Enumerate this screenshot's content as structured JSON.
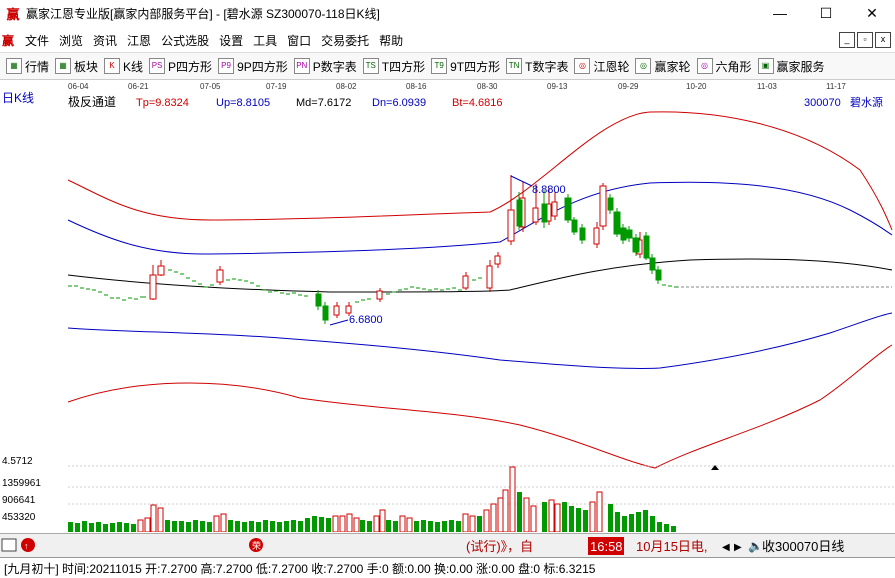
{
  "window": {
    "title": "赢家江恩专业版[赢家内部服务平台] - [碧水源  SZ300070-118日K线]",
    "logo": "赢",
    "minimize": "—",
    "maximize": "☐",
    "close": "✕"
  },
  "menu": {
    "logo": "赢",
    "items": [
      "文件",
      "浏览",
      "资讯",
      "江恩",
      "公式选股",
      "设置",
      "工具",
      "窗口",
      "交易委托",
      "帮助"
    ]
  },
  "toolbar": {
    "items": [
      {
        "icon": "grid-icon",
        "icon_text": "▦",
        "label": "行情"
      },
      {
        "icon": "blocks-icon",
        "icon_text": "▦",
        "label": "板块"
      },
      {
        "icon": "kline-icon",
        "icon_text": "K",
        "label": "K线"
      },
      {
        "icon": "p-square-icon",
        "icon_text": "PS",
        "label": "P四方形"
      },
      {
        "icon": "p9-icon",
        "icon_text": "P9",
        "label": "9P四方形"
      },
      {
        "icon": "pn-icon",
        "icon_text": "PN",
        "label": "P数字表"
      },
      {
        "icon": "t-square-icon",
        "icon_text": "TS",
        "label": "T四方形"
      },
      {
        "icon": "t9-icon",
        "icon_text": "T9",
        "label": "9T四方形"
      },
      {
        "icon": "tn-icon",
        "icon_text": "TN",
        "label": "T数字表"
      },
      {
        "icon": "gann-wheel-icon",
        "icon_text": "◎",
        "label": "江恩轮"
      },
      {
        "icon": "winner-wheel-icon",
        "icon_text": "◎",
        "label": "赢家轮"
      },
      {
        "icon": "hexagon-icon",
        "icon_text": "◎",
        "label": "六角形"
      },
      {
        "icon": "service-icon",
        "icon_text": "▣",
        "label": "赢家服务"
      }
    ]
  },
  "chart": {
    "period_label": "日K线",
    "indicator_name": "极反通道",
    "params": [
      {
        "text": "Tp=9.8324",
        "color": "#d00000"
      },
      {
        "text": "Up=8.8105",
        "color": "#0000c0"
      },
      {
        "text": "Md=7.6172",
        "color": "#000000"
      },
      {
        "text": "Dn=6.0939",
        "color": "#0000c0"
      },
      {
        "text": "Bt=4.6816",
        "color": "#d00000"
      }
    ],
    "stock_code": "300070",
    "stock_name": "碧水源",
    "dates": [
      "06-04",
      "06-21",
      "07-05",
      "07-19",
      "08-02",
      "08-16",
      "08-30",
      "09-13",
      "09-29",
      "10-20",
      "11-03",
      "11-17"
    ],
    "high_label": "8.8800",
    "low_label": "6.6800",
    "volume_scale": [
      "4.5712",
      "1359961",
      "906641",
      "453320"
    ]
  },
  "bottom": {
    "ticker_text": "(试行)》，自",
    "ticker_time": "16:58",
    "ticker_date": "10月15日电,",
    "right_label": "收300070日线"
  },
  "status": {
    "text": "[九月初十] 时间:20211015 开:7.2700 高:7.2700 低:7.2700 收:7.2700 手:0 额:0.00 换:0.00 涨:0.00 盘:0 标:6.3215"
  }
}
